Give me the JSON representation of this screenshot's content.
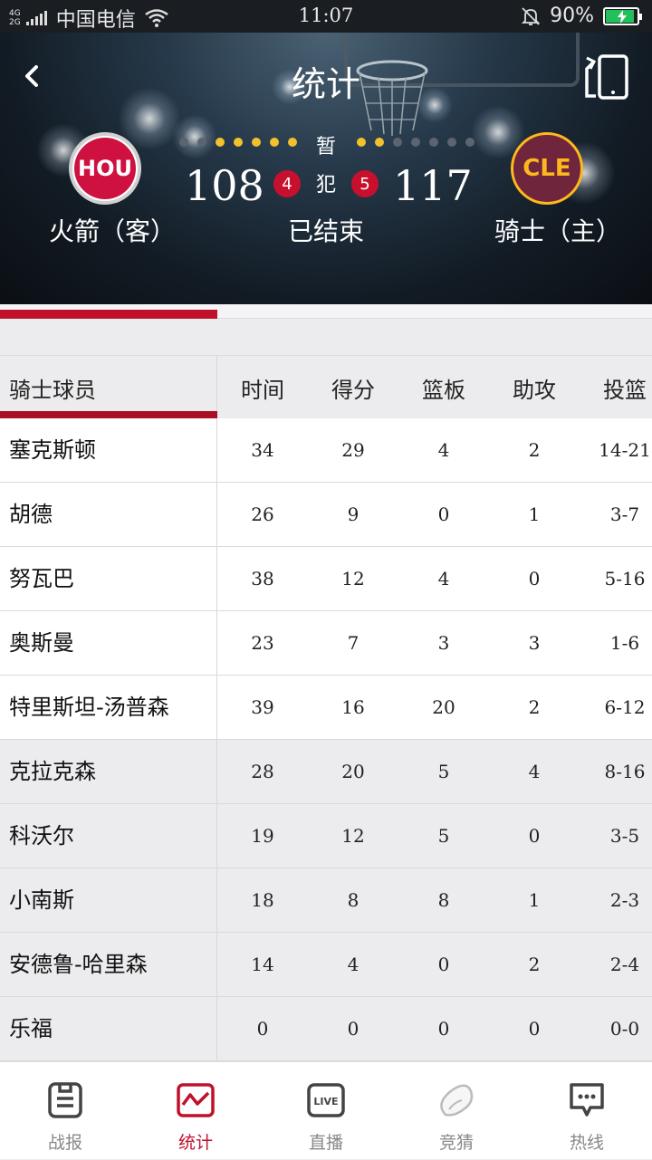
{
  "status_bar": {
    "network_top": "4G",
    "network_bottom": "2G",
    "carrier": "中国电信",
    "time": "11:07",
    "battery": "90%",
    "battery_level": 0.9
  },
  "header": {
    "title": "统计",
    "timeout_label": "暂",
    "foul_label": "犯",
    "status": "已结束",
    "away": {
      "abbr": "HOU",
      "name": "火箭（客）",
      "score": "108",
      "fouls": "4",
      "timeouts_used": 5,
      "timeouts_total": 7
    },
    "home": {
      "abbr": "CLE",
      "name": "骑士（主）",
      "score": "117",
      "fouls": "5",
      "timeouts_used": 2,
      "timeouts_total": 7
    }
  },
  "colors": {
    "accent": "#c0112b",
    "hou_red": "#ce1141",
    "cle_wine": "#6f263d",
    "cle_gold": "#ffb81c",
    "timeout_active": "#f2c12e",
    "timeout_inactive": "#5b6470"
  },
  "table": {
    "player_header": "骑士球员",
    "columns": [
      "时间",
      "得分",
      "篮板",
      "助攻",
      "投篮"
    ],
    "starters": [
      {
        "name": "塞克斯顿",
        "stats": [
          "34",
          "29",
          "4",
          "2",
          "14-21"
        ]
      },
      {
        "name": "胡德",
        "stats": [
          "26",
          "9",
          "0",
          "1",
          "3-7"
        ]
      },
      {
        "name": "努瓦巴",
        "stats": [
          "38",
          "12",
          "4",
          "0",
          "5-16"
        ]
      },
      {
        "name": "奥斯曼",
        "stats": [
          "23",
          "7",
          "3",
          "3",
          "1-6"
        ]
      },
      {
        "name": "特里斯坦-汤普森",
        "stats": [
          "39",
          "16",
          "20",
          "2",
          "6-12"
        ]
      }
    ],
    "bench": [
      {
        "name": "克拉克森",
        "stats": [
          "28",
          "20",
          "5",
          "4",
          "8-16"
        ]
      },
      {
        "name": "科沃尔",
        "stats": [
          "19",
          "12",
          "5",
          "0",
          "3-5"
        ]
      },
      {
        "name": "小南斯",
        "stats": [
          "18",
          "8",
          "8",
          "1",
          "2-3"
        ]
      },
      {
        "name": "安德鲁-哈里森",
        "stats": [
          "14",
          "4",
          "0",
          "2",
          "2-4"
        ]
      },
      {
        "name": "乐福",
        "stats": [
          "0",
          "0",
          "0",
          "0",
          "0-0"
        ]
      }
    ]
  },
  "bottom_nav": [
    {
      "label": "战报",
      "icon": "clipboard-icon",
      "active": false
    },
    {
      "label": "统计",
      "icon": "stats-chart-icon",
      "active": true
    },
    {
      "label": "直播",
      "icon": "live-tv-icon",
      "active": false
    },
    {
      "label": "竞猜",
      "icon": "bean-icon",
      "active": false
    },
    {
      "label": "热线",
      "icon": "chat-bubble-icon",
      "active": false
    }
  ]
}
